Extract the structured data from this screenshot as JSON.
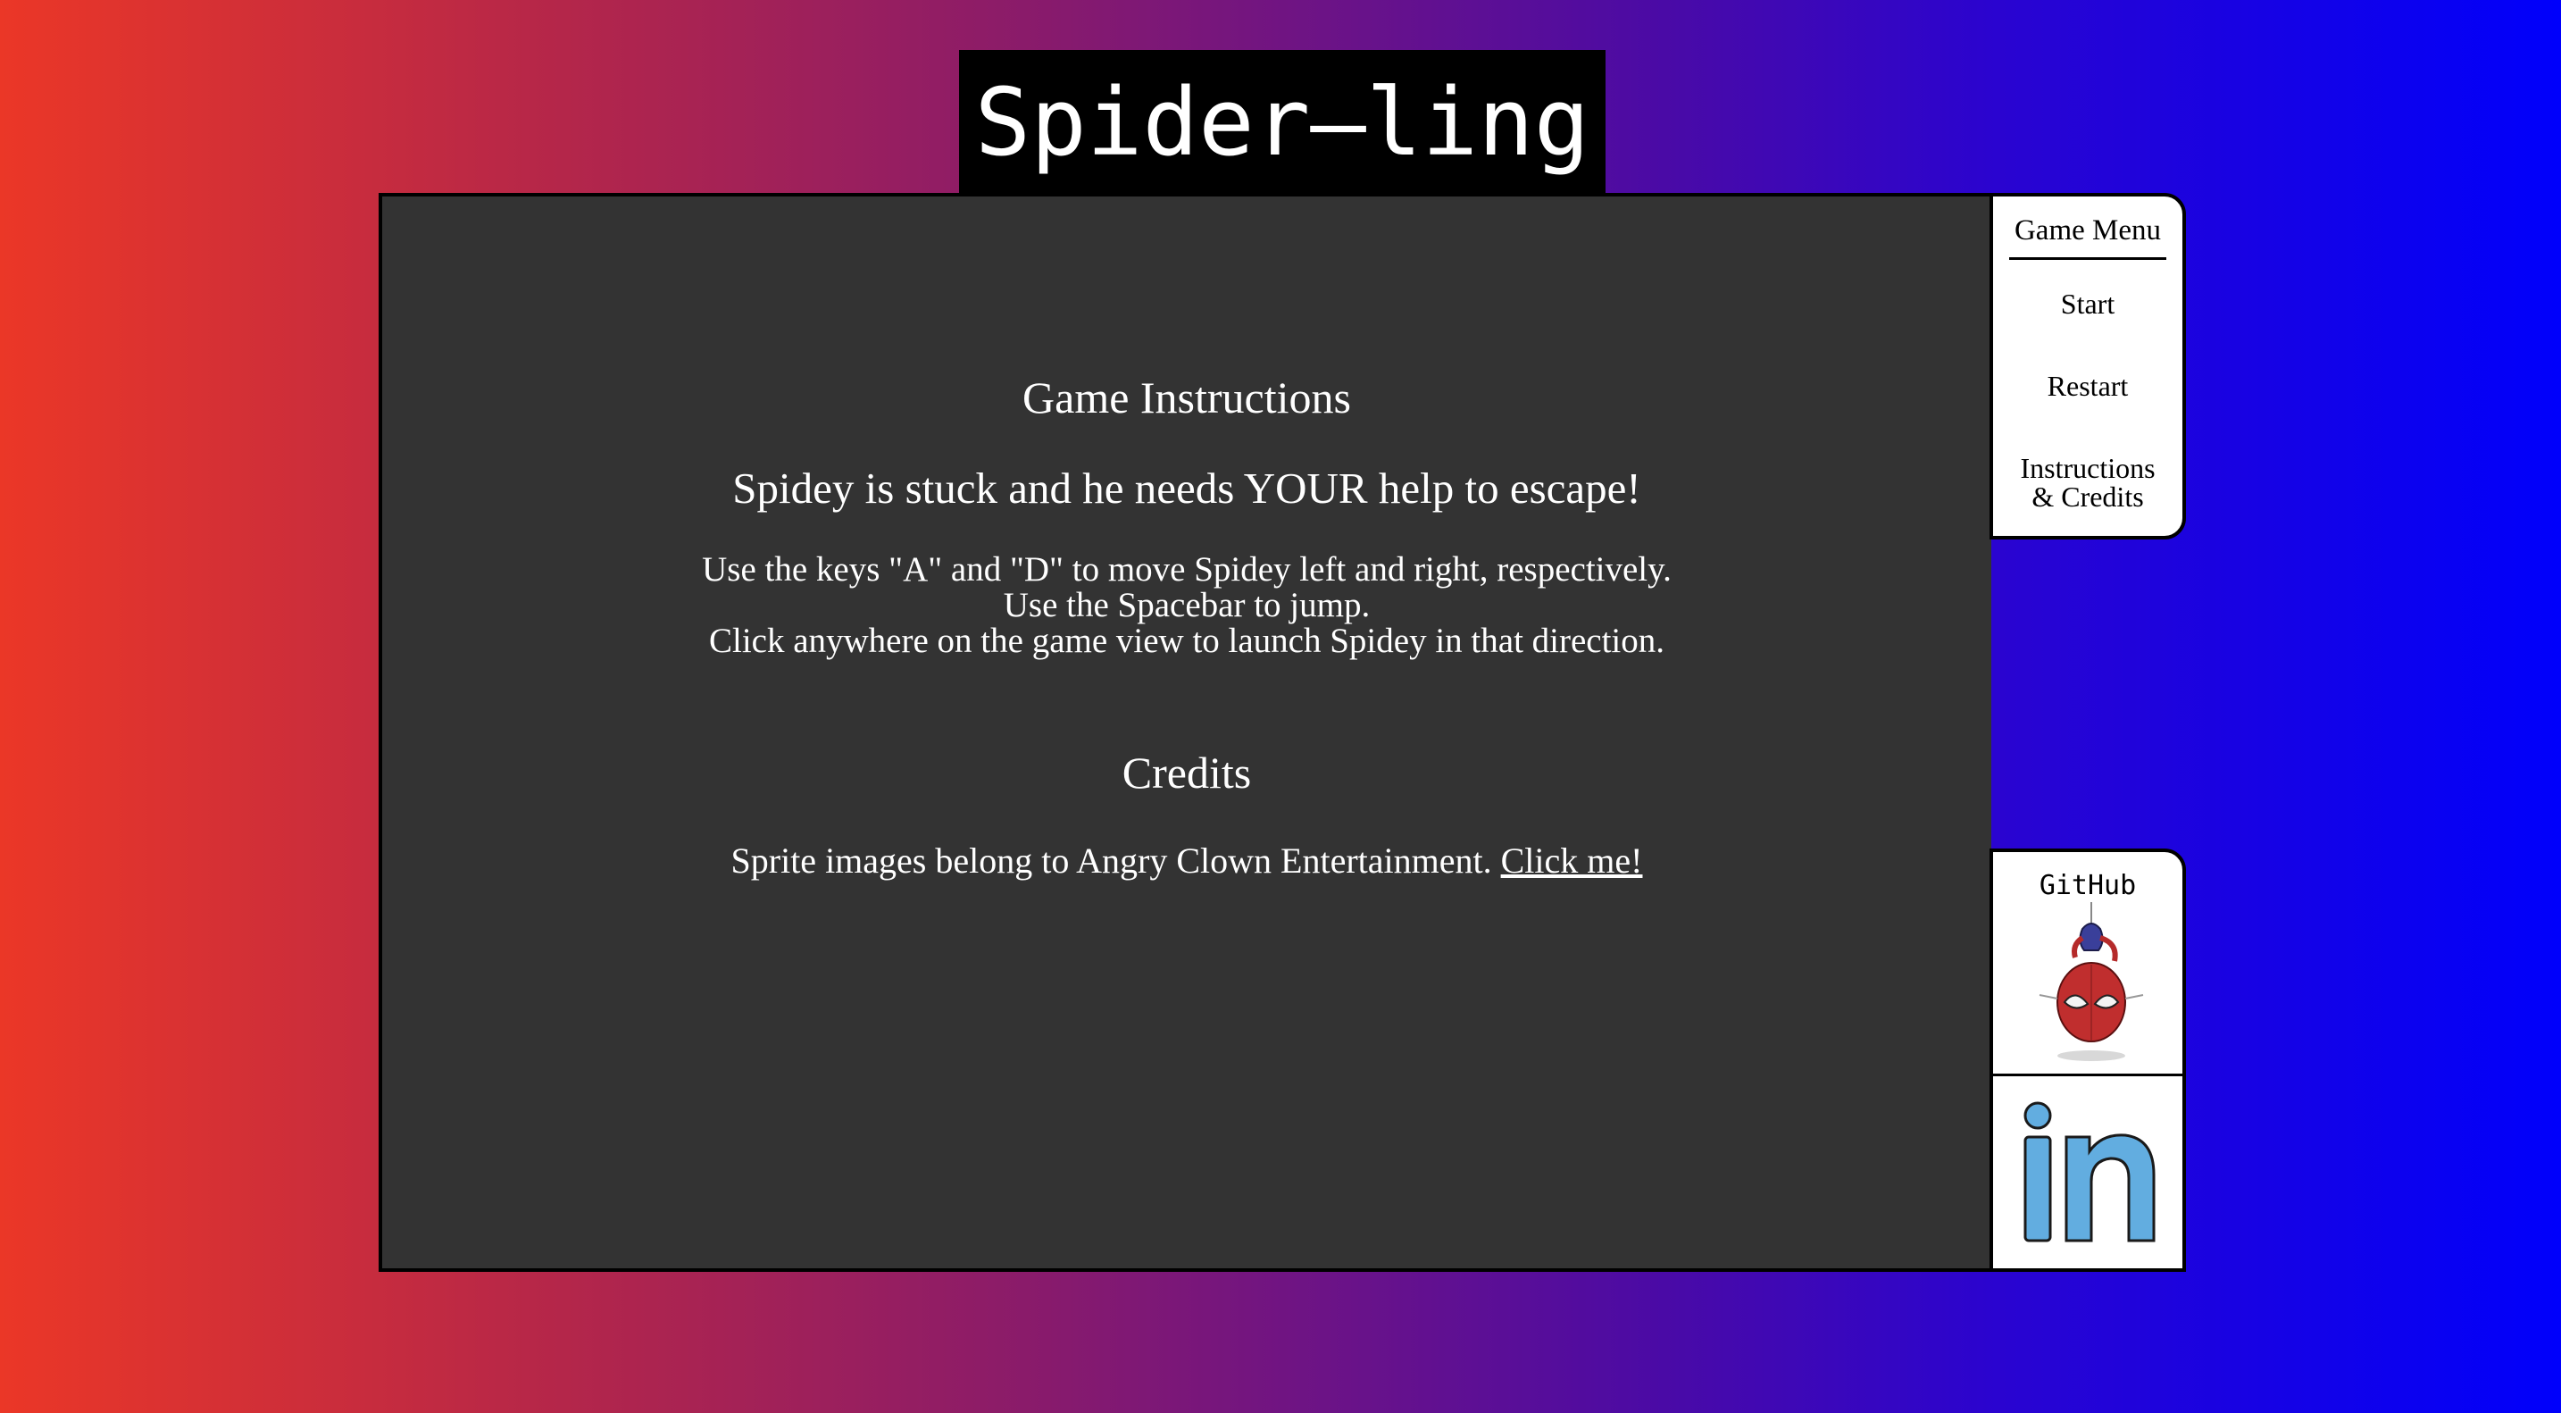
{
  "title": "Spider–ling",
  "game_view": {
    "instructions_title": "Game Instructions",
    "instructions_subtitle": "Spidey is stuck and he needs YOUR help to escape!",
    "instructions_lines": [
      "Use the keys \"A\" and \"D\" to move Spidey left and right, respectively.",
      "Use the Spacebar to jump.",
      "Click anywhere on the game view to launch Spidey in that direction."
    ],
    "credits_title": "Credits",
    "credits_text": "Sprite images belong to Angry Clown Entertainment. ",
    "credits_link": "Click me!"
  },
  "menu": {
    "heading": "Game Menu",
    "start": "Start",
    "restart": "Restart",
    "instructions_line1": "Instructions",
    "instructions_line2": "& Credits"
  },
  "social": {
    "github_label": "GitHub",
    "github_icon": "spidey-sprite-icon",
    "linkedin_icon": "linkedin-icon"
  },
  "colors": {
    "gradient_start": "#eb3727",
    "gradient_end": "#0000fb",
    "game_bg": "#333333",
    "linkedin_blue": "#62ade0"
  }
}
